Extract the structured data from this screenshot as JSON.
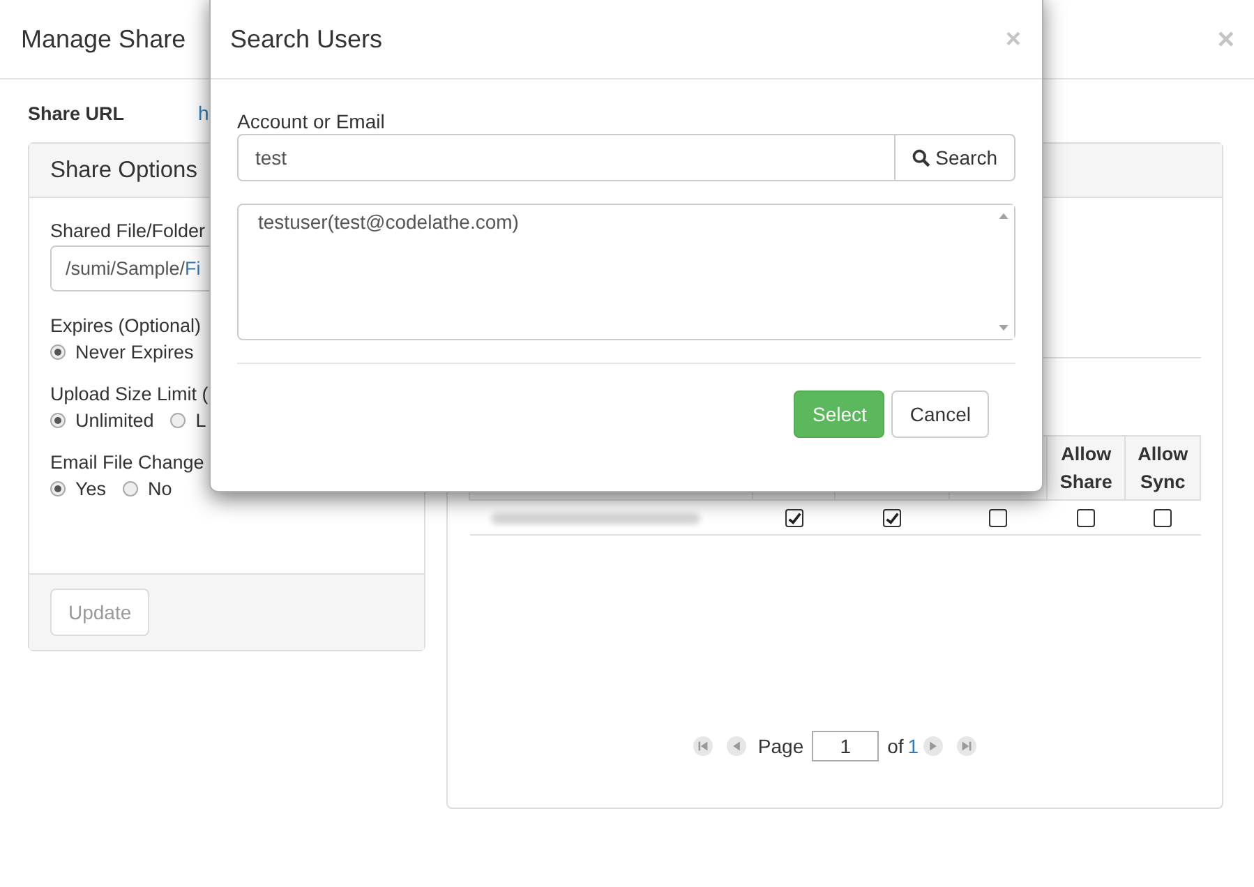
{
  "manage_share": {
    "title": "Manage Share",
    "close": "×",
    "share_url": {
      "label": "Share URL",
      "value": "h"
    },
    "share_options": {
      "title": "Share Options",
      "shared_path": {
        "label": "Shared File/Folder",
        "value": "/sumi/Sample/",
        "value_link": "Fi"
      },
      "groups": [
        {
          "label": "Expires (Optional)",
          "options": [
            {
              "label": "Never Expires",
              "selected": true
            }
          ]
        },
        {
          "label": "Upload Size Limit (",
          "options": [
            {
              "label": "Unlimited",
              "selected": true
            },
            {
              "label": "L",
              "selected": false
            }
          ]
        },
        {
          "label": "Email File Change",
          "options": [
            {
              "label": "Yes",
              "selected": true
            },
            {
              "label": "No",
              "selected": false
            }
          ]
        }
      ],
      "update_button": {
        "label": "Update",
        "disabled": true
      }
    },
    "users_table": {
      "visible_columns": [
        {
          "label": "Allow Share"
        },
        {
          "label": "Allow Sync"
        }
      ],
      "rows": [
        {
          "permissions": [
            {
              "checked": true
            },
            {
              "checked": true
            },
            {
              "checked": false
            },
            {
              "checked": false
            },
            {
              "checked": false
            }
          ]
        }
      ]
    },
    "pagination": {
      "page_label": "Page",
      "page": "1",
      "of_label": "of",
      "total": "1"
    }
  },
  "search_dialog": {
    "title": "Search Users",
    "close": "×",
    "field_label": "Account or Email",
    "value": "test",
    "search_button": "Search",
    "results": [
      {
        "label": "testuser(test@codelathe.com)"
      }
    ],
    "buttons": [
      {
        "label": "Select",
        "kind": "primary"
      },
      {
        "label": "Cancel",
        "kind": "default"
      }
    ]
  }
}
